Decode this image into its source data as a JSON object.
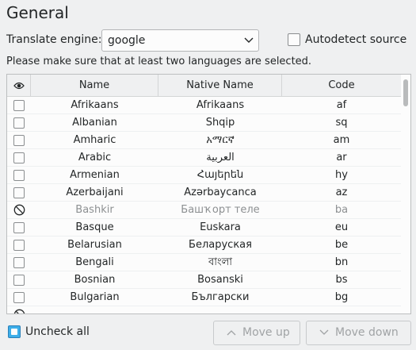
{
  "heading": "General",
  "engine": {
    "label": "Translate engine:",
    "selected": "google",
    "chevron_icon": "chevron-down-icon"
  },
  "autodetect": {
    "label": "Autodetect source",
    "checked": false
  },
  "hint": "Please make sure that at least two languages are selected.",
  "table": {
    "header_icon": "eye-icon",
    "columns": [
      "Name",
      "Native Name",
      "Code"
    ],
    "rows": [
      {
        "name": "Afrikaans",
        "native": "Afrikaans",
        "code": "af",
        "state": "unchecked"
      },
      {
        "name": "Albanian",
        "native": "Shqip",
        "code": "sq",
        "state": "unchecked"
      },
      {
        "name": "Amharic",
        "native": "አማርኛ",
        "code": "am",
        "state": "unchecked"
      },
      {
        "name": "Arabic",
        "native": "العربية",
        "code": "ar",
        "state": "unchecked"
      },
      {
        "name": "Armenian",
        "native": "Հայերեն",
        "code": "hy",
        "state": "unchecked"
      },
      {
        "name": "Azerbaijani",
        "native": "Azərbaycanca",
        "code": "az",
        "state": "unchecked"
      },
      {
        "name": "Bashkir",
        "native": "Башҡорт теле",
        "code": "ba",
        "state": "disabled"
      },
      {
        "name": "Basque",
        "native": "Euskara",
        "code": "eu",
        "state": "unchecked"
      },
      {
        "name": "Belarusian",
        "native": "Беларуская",
        "code": "be",
        "state": "unchecked"
      },
      {
        "name": "Bengali",
        "native": "বাংলা",
        "code": "bn",
        "state": "unchecked"
      },
      {
        "name": "Bosnian",
        "native": "Bosanski",
        "code": "bs",
        "state": "unchecked"
      },
      {
        "name": "Bulgarian",
        "native": "Български",
        "code": "bg",
        "state": "unchecked"
      }
    ]
  },
  "uncheck_all": {
    "label": "Uncheck all"
  },
  "buttons": {
    "move_up": "Move up",
    "move_down": "Move down",
    "up_icon": "chevron-up-icon",
    "down_icon": "chevron-down-icon"
  },
  "colors": {
    "accent": "#3daee9",
    "window_bg": "#eff0f1",
    "view_bg": "#fcfcfc",
    "disabled_text": "#8d9092"
  }
}
